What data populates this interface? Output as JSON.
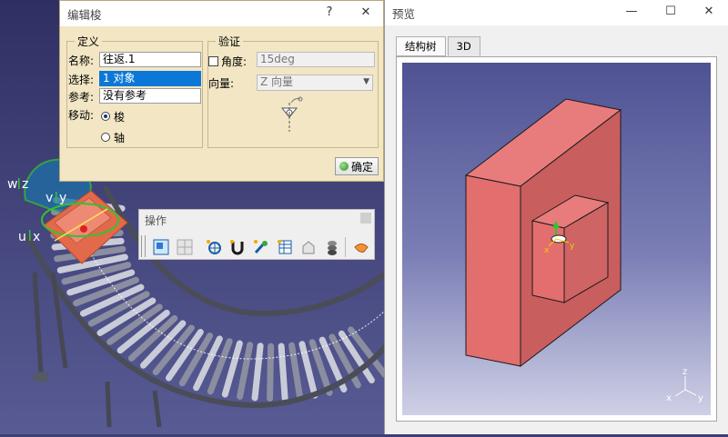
{
  "viewport": {
    "axis_labels": {
      "w": "w",
      "z": "z",
      "v": "v",
      "y": "y",
      "u": "u",
      "x": "x"
    }
  },
  "edit_dialog": {
    "title": "编辑梭",
    "help_glyph": "?",
    "close_glyph": "✕",
    "definition": {
      "legend": "定义",
      "name_label": "名称:",
      "name_value": "往返.1",
      "select_label": "选择:",
      "select_value": "1 对象",
      "ref_label": "参考:",
      "ref_value": "没有参考",
      "move_label": "移动:",
      "move_option_shuttle": "梭",
      "move_option_axis": "轴",
      "move_selected": "梭"
    },
    "validation": {
      "legend": "验证",
      "angle_label": "角度:",
      "angle_value": "15deg",
      "angle_checked": false,
      "vector_label": "向量:",
      "vector_value": "Z 向量"
    },
    "ok_label": "确定"
  },
  "operations_toolbar": {
    "title": "操作",
    "tools": [
      "view-fit-icon",
      "grid-icon",
      "move-compass-icon",
      "snap-magnet-icon",
      "manipulate-icon",
      "table-icon",
      "reset-icon",
      "stack-icon",
      "hand-icon"
    ]
  },
  "preview_window": {
    "title": "预览",
    "minimize_glyph": "—",
    "maximize_glyph": "☐",
    "close_glyph": "✕",
    "tabs": [
      {
        "label": "结构树",
        "active": false
      },
      {
        "label": "3D",
        "active": true
      }
    ],
    "axis_labels": {
      "z": "z",
      "y": "y",
      "x": "x"
    },
    "mini_axis_labels": {
      "x": "x",
      "y": "y"
    }
  },
  "colors": {
    "dialog_bg": "#f2e6c4",
    "selection_blue": "#0b78d7",
    "block_face": "#e56e6e",
    "block_side": "#c65858",
    "compass_green": "#33c233"
  }
}
